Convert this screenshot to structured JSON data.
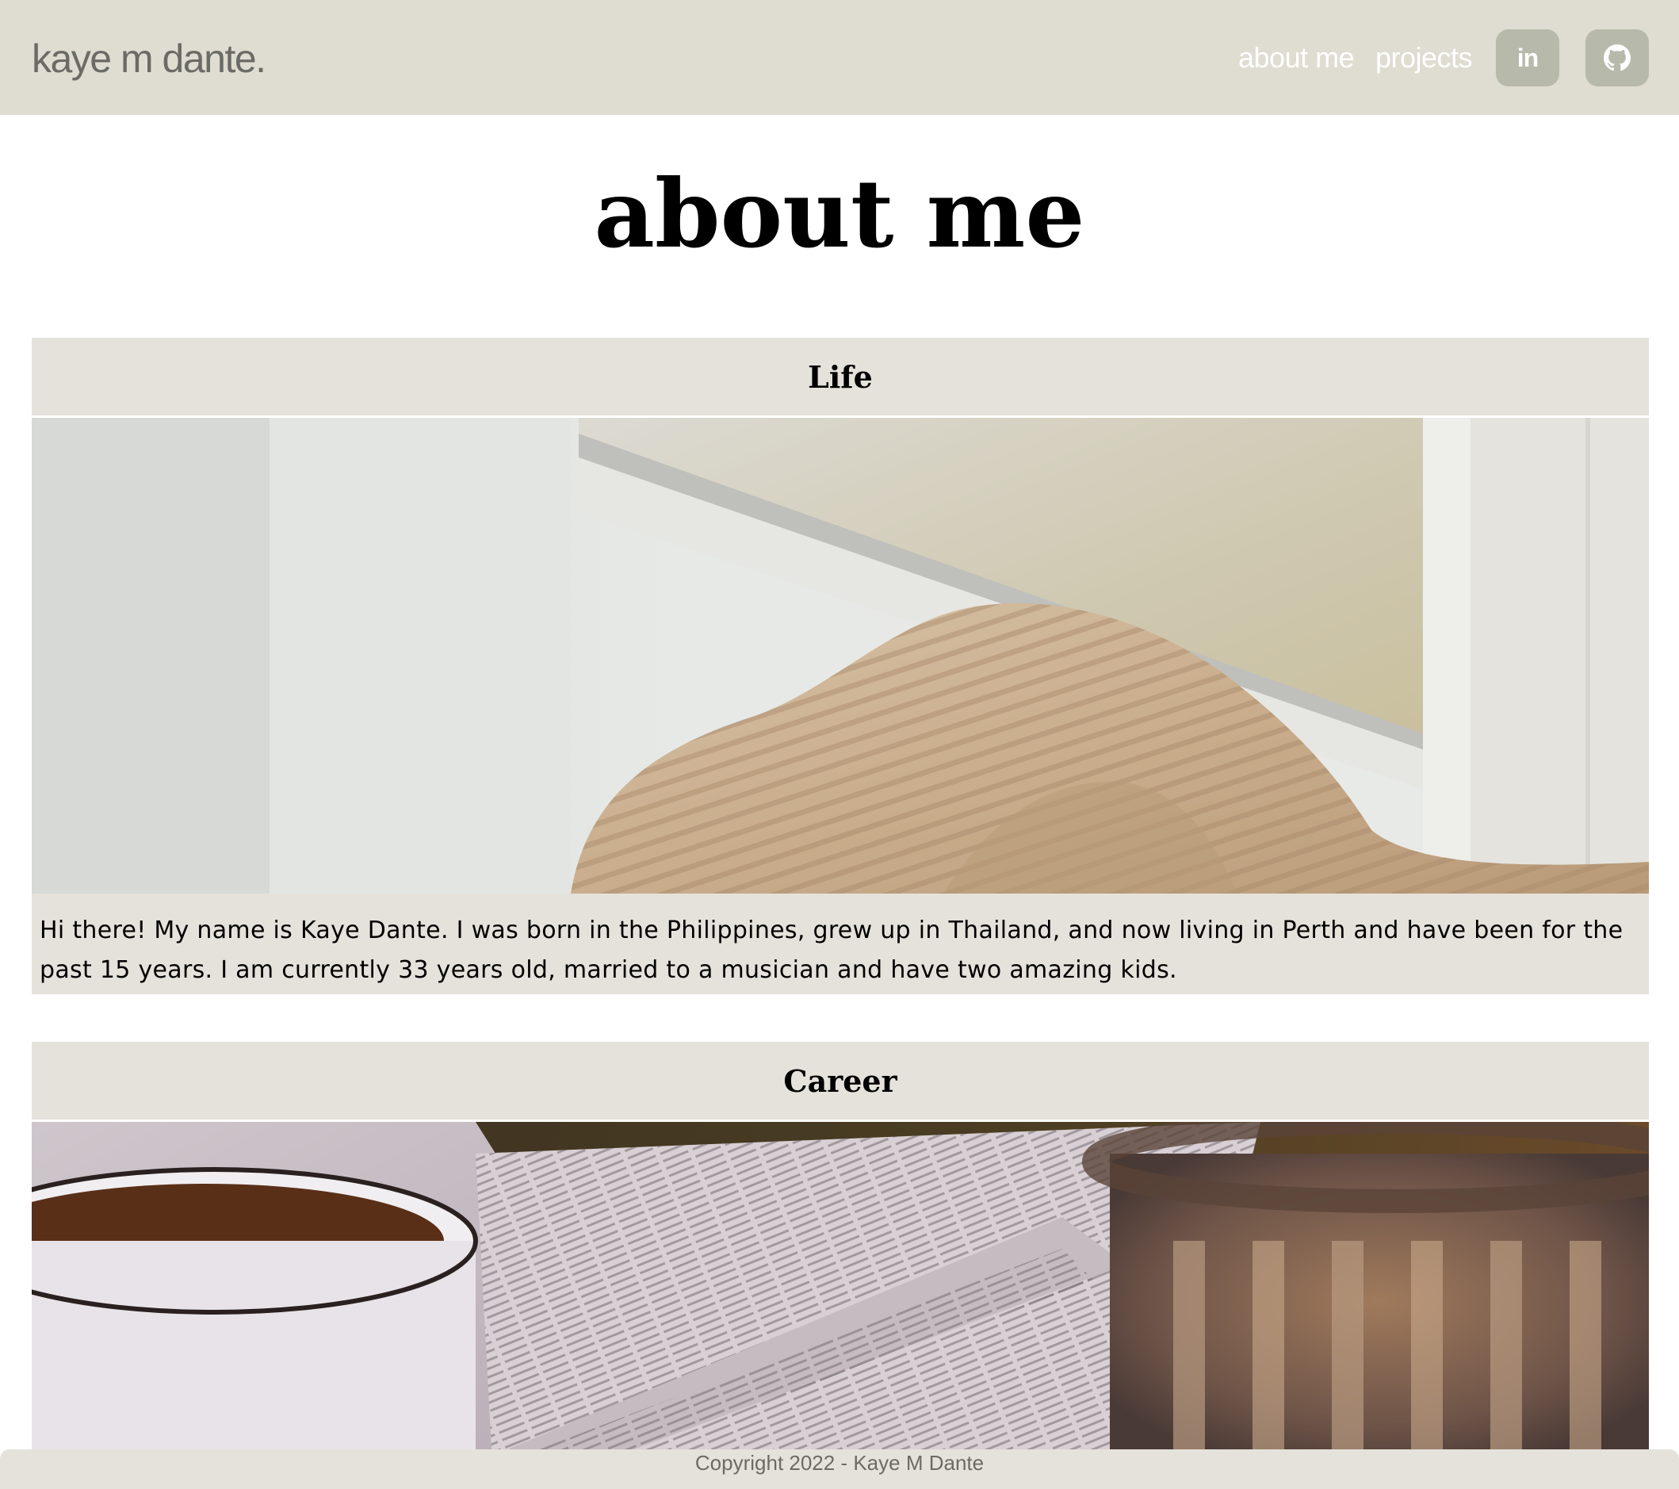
{
  "nav": {
    "brand": "kaye m dante.",
    "links": [
      {
        "label": "about me"
      },
      {
        "label": "projects"
      }
    ],
    "icons": [
      {
        "name": "linkedin-icon",
        "glyph": "in"
      },
      {
        "name": "github-icon"
      }
    ]
  },
  "main": {
    "title": "about me",
    "sections": [
      {
        "heading": "Life",
        "image": "knit-sweater-on-windowsill-photo",
        "text": "Hi there! My name is Kaye Dante. I was born in the Philippines, grew up in Thailand, and now living in Perth and have been for the past 15 years. I am currently 33 years old, married to a musician and have two amazing kids."
      },
      {
        "heading": "Career",
        "image": "open-book-coffee-mug-candle-photo"
      }
    ]
  },
  "footer": {
    "copyright": "Copyright 2022 - Kaye M Dante"
  },
  "colors": {
    "nav_background": "#dfdcd1",
    "card_background": "#e5e2db",
    "icon_button": "#b7b9ab",
    "brand_text": "#6b6b66"
  }
}
